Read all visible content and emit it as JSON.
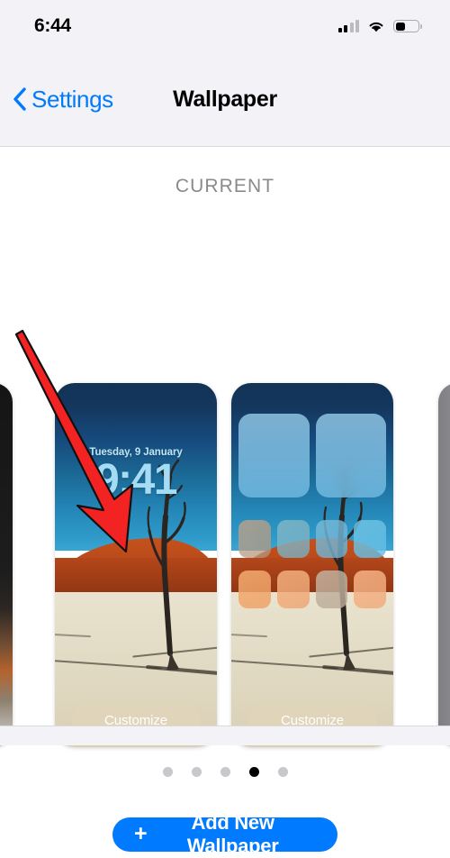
{
  "status_bar": {
    "time": "6:44",
    "cellular_icon": "cellular-bars-icon",
    "wifi_icon": "wifi-icon",
    "battery_icon": "battery-icon",
    "signal_bars_filled": 2,
    "signal_bars_total": 4,
    "battery_level_percent": 38
  },
  "nav": {
    "back_icon": "chevron-left-icon",
    "back_label": "Settings",
    "title": "Wallpaper"
  },
  "main": {
    "section_header": "CURRENT",
    "lock_screen": {
      "date": "Tuesday, 9 January",
      "time": "9:41",
      "customize_label": "Customize"
    },
    "home_screen": {
      "customize_label": "Customize",
      "widget_count": 2,
      "icon_rows": 2,
      "icons_per_row": 4
    },
    "pagination": {
      "total": 5,
      "active_index": 4
    },
    "add_button": {
      "plus_icon": "plus-icon",
      "label": "Add New Wallpaper"
    }
  },
  "annotation": {
    "arrow_color": "#f42323",
    "points_to": "lock-screen-customize-button"
  },
  "colors": {
    "accent_blue": "#007aff",
    "bar_background": "#f2f2f7",
    "section_header": "#8a8a8e",
    "dot_inactive": "#c8c7cc",
    "dot_active": "#000000",
    "lock_time_tint": "#a5dcf5"
  }
}
